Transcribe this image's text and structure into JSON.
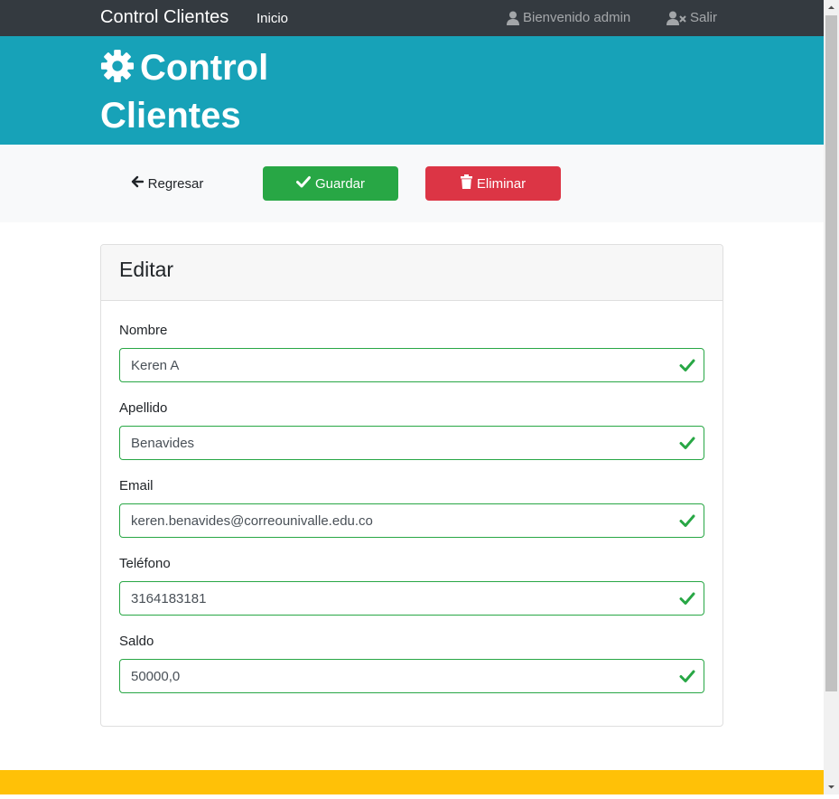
{
  "navbar": {
    "brand": "Control Clientes",
    "inicio_label": "Inicio",
    "welcome_label": "Bienvenido admin",
    "logout_label": "Salir"
  },
  "header": {
    "title": "Control Clientes",
    "icon": "cog-icon"
  },
  "actions": {
    "back_label": "Regresar",
    "save_label": "Guardar",
    "delete_label": "Eliminar"
  },
  "card": {
    "title": "Editar"
  },
  "form": {
    "nombre": {
      "label": "Nombre",
      "value": "Keren A"
    },
    "apellido": {
      "label": "Apellido",
      "value": "Benavides"
    },
    "email": {
      "label": "Email",
      "value": "keren.benavides@correounivalle.edu.co"
    },
    "telefono": {
      "label": "Teléfono",
      "value": "3164183181"
    },
    "saldo": {
      "label": "Saldo",
      "value": "50000,0"
    }
  },
  "colors": {
    "navbar": "#343a40",
    "header": "#17a2b8",
    "save": "#28a745",
    "delete": "#dc3545",
    "footer": "#ffc107",
    "valid": "#28a745"
  }
}
